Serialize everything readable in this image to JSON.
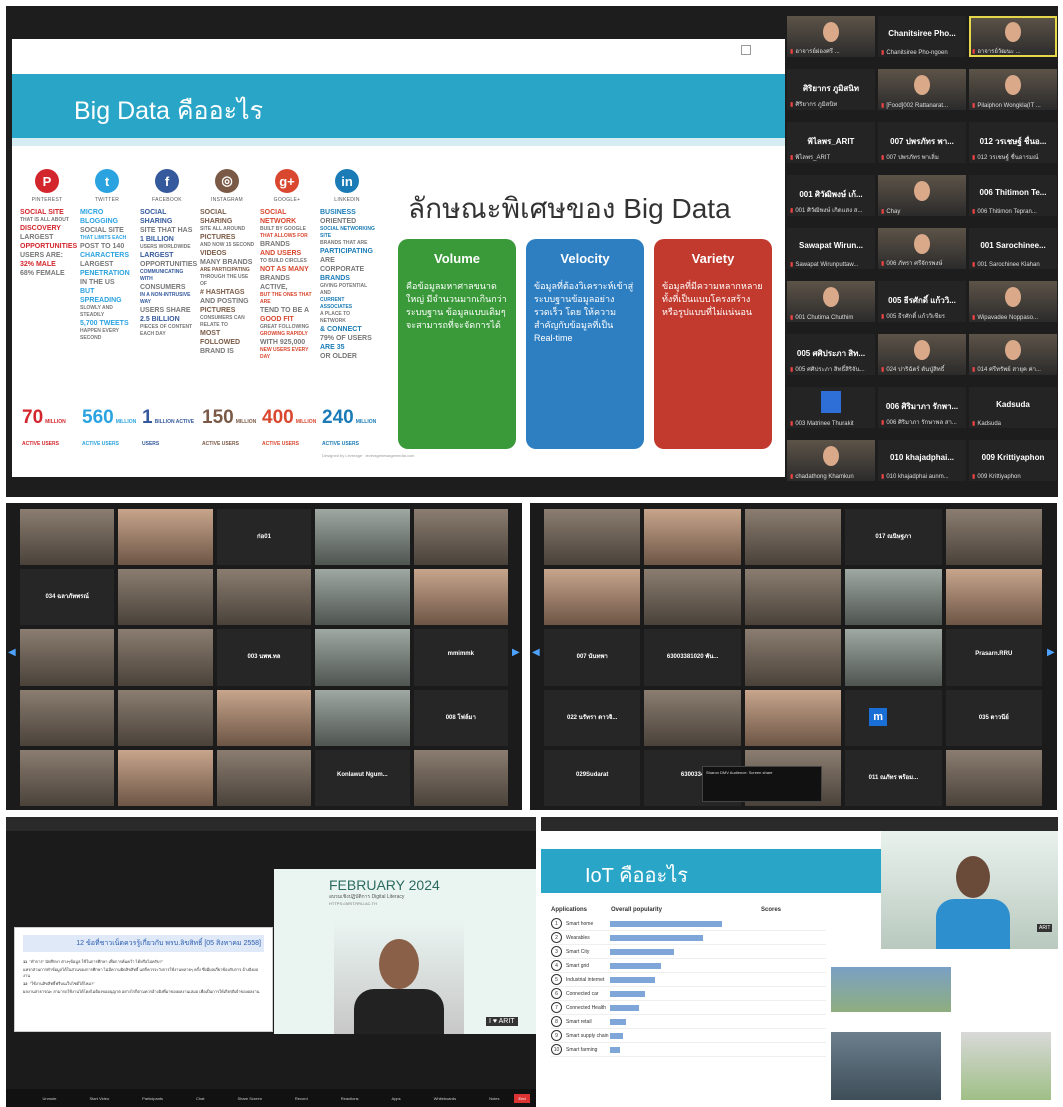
{
  "panel1": {
    "slide_title": "Big Data คืออะไร",
    "social": [
      {
        "icon": "P",
        "name": "PINTEREST",
        "color": "#d3262c",
        "lines": [
          "SOCIAL SITE",
          "THAT IS ALL ABOUT",
          "DISCOVERY",
          "LARGEST",
          "OPPORTUNITIES",
          "USERS ARE:",
          "32% MALE",
          "68% FEMALE"
        ],
        "big": "70",
        "unit": "MILLION ACTIVE USERS"
      },
      {
        "icon": "t",
        "name": "TWITTER",
        "color": "#2aa3e0",
        "lines": [
          "MICRO BLOGGING",
          "SOCIAL SITE",
          "THAT LIMITS EACH",
          "POST TO 140",
          "CHARACTERS",
          "LARGEST",
          "PENETRATION",
          "IN THE US",
          "BUT SPREADING",
          "SLOWLY AND STEADILY",
          "5,700 TWEETS",
          "HAPPEN EVERY SECOND"
        ],
        "big": "560",
        "unit": "MILLION ACTIVE USERS"
      },
      {
        "icon": "f",
        "name": "FACEBOOK",
        "color": "#34599c",
        "lines": [
          "SOCIAL SHARING",
          "SITE THAT HAS",
          "1 BILLION",
          "USERS WORLDWIDE",
          "LARGEST",
          "OPPORTUNITIES",
          "COMMUNICATING WITH",
          "CONSUMERS",
          "IN A NON-INTRUSIVE WAY",
          "USERS SHARE",
          "2.5 BILLION",
          "PIECES OF CONTENT EACH DAY"
        ],
        "big": "1",
        "unit": "BILLION ACTIVE USERS"
      },
      {
        "icon": "◎",
        "name": "INSTAGRAM",
        "color": "#7a5a46",
        "lines": [
          "SOCIAL SHARING",
          "SITE ALL AROUND",
          "PICTURES",
          "AND NOW 15 SECOND",
          "VIDEOS",
          "MANY BRANDS",
          "ARE PARTICIPATING",
          "THROUGH THE USE OF",
          "# HASHTAGS",
          "AND POSTING",
          "PICTURES",
          "CONSUMERS CAN RELATE TO",
          "MOST FOLLOWED",
          "BRAND IS"
        ],
        "big": "150",
        "unit": "MILLION ACTIVE USERS"
      },
      {
        "icon": "g+",
        "name": "GOOGLE+",
        "color": "#d9472f",
        "lines": [
          "SOCIAL NETWORK",
          "BUILT BY GOOGLE",
          "THAT ALLOWS FOR",
          "BRANDS",
          "AND USERS",
          "TO BUILD CIRCLES",
          "NOT AS MANY",
          "BRANDS ACTIVE,",
          "BUT THE ONES THAT ARE",
          "TEND TO BE A",
          "GOOD FIT",
          "GREAT FOLLOWING",
          "GROWING RAPIDLY",
          "WITH 925,000",
          "NEW USERS EVERY DAY"
        ],
        "big": "400",
        "unit": "MILLION ACTIVE USERS"
      },
      {
        "icon": "in",
        "name": "LINKEDIN",
        "color": "#1a7bb6",
        "lines": [
          "BUSINESS",
          "ORIENTED",
          "SOCIAL NETWORKING SITE",
          "BRANDS THAT ARE",
          "PARTICIPATING",
          "ARE CORPORATE",
          "BRANDS",
          "GIVING POTENTIAL AND",
          "CURRENT ASSOCIATES",
          "A PLACE TO NETWORK",
          "& CONNECT",
          "79% OF USERS",
          "ARE 35",
          "OR OLDER"
        ],
        "big": "240",
        "unit": "MILLION ACTIVE USERS"
      }
    ],
    "feature_title": "ลักษณะพิเศษของ Big Data",
    "boxes": [
      {
        "title": "Volume",
        "color": "#3a9a3a",
        "text": "คือข้อมูลมหาศาลขนาดใหญ่ มีจำนวนมากเกินกว่าระบบฐาน ข้อมูลแบบเดิมๆ จะสามารถที่จะจัดการได้"
      },
      {
        "title": "Velocity",
        "color": "#2e7ec2",
        "text": "ข้อมูลที่ต้องวิเคราะห์เข้าสู่ระบบฐานข้อมูลอย่างรวดเร็ว โดย ให้ความสำคัญกับข้อมูลที่เป็น Real-time"
      },
      {
        "title": "Variety",
        "color": "#c23a2e",
        "text": "ข้อมูลที่มีความหลากหลายทั้งที่เป็นแบบโครงสร้างหรือรูปแบบที่ไม่แน่นอน"
      }
    ],
    "credit": "Designed by Leverage · leveragenewagemedia.com",
    "participants": [
      {
        "name": "",
        "caption": "อาจารย์ผ่องศรี ...",
        "photo": true
      },
      {
        "name": "Chanitsiree Pho...",
        "caption": "Chanitsiree Pho-ngoen",
        "photo": false
      },
      {
        "name": "",
        "caption": "อาจารย์วัฒนะ ...",
        "photo": true,
        "active": true
      },
      {
        "name": "ศิริยากร ภูมิสนิท",
        "caption": "ศิริยากร ภูมิสนิท",
        "photo": false
      },
      {
        "name": "",
        "caption": "[Food]002 Rattanarat...",
        "photo": true
      },
      {
        "name": "",
        "caption": "Pilaiphon Wongkla(IT ...",
        "photo": true
      },
      {
        "name": "พิไลพร_ARIT",
        "caption": "พิไลพร_ARIT",
        "photo": false
      },
      {
        "name": "007 ปพรภัทร พา...",
        "caption": "007 ปพรภัทร พาเลิ่ม",
        "photo": false
      },
      {
        "name": "012 วรเชษฐ์ ชื่นอ...",
        "caption": "012 วรเชษฐ์ ชื่นอารมณ์",
        "photo": false
      },
      {
        "name": "001 ศิวัฒิพงษ์ เก้...",
        "caption": "001 ศิวัฒิพงษ์ เกิดแสง ส...",
        "photo": false
      },
      {
        "name": "",
        "caption": "Chay",
        "photo": true
      },
      {
        "name": "006 Thitimon Te...",
        "caption": "006 Thitimon Tepran...",
        "photo": false
      },
      {
        "name": "Sawapat Wirun...",
        "caption": "Sawapat Wirunputtaw...",
        "photo": false
      },
      {
        "name": "",
        "caption": "006 ภัทรา ศรีจักรพงษ์",
        "photo": true
      },
      {
        "name": "001 Sarochinee...",
        "caption": "001 Sarochinee Klahan",
        "photo": false
      },
      {
        "name": "",
        "caption": "001 Chutima Chuthim",
        "photo": true
      },
      {
        "name": "005 ธีรศักดิ์ แก้ววิ...",
        "caption": "005 ธีรศักดิ์ แก้ววิเชียร",
        "photo": false
      },
      {
        "name": "",
        "caption": "Wipavadee Noppaso...",
        "photo": true
      },
      {
        "name": "005 ศศิประภา สิท...",
        "caption": "005 ศศิประภา สิทธิ์สิริจัน...",
        "photo": false
      },
      {
        "name": "",
        "caption": "024 ปาริฉัตร์ ตันปู่สิทธิ์",
        "photo": true
      },
      {
        "name": "",
        "caption": "014 ศรีทรัพย์ สายุค ค่า...",
        "photo": true
      },
      {
        "name": "",
        "caption": "003 Matrinee Thurakit",
        "photo": false,
        "avatar": true
      },
      {
        "name": "006 ศิริมาภา รักพา...",
        "caption": "006 ศิริมาภา รักษาพล สา...",
        "photo": false
      },
      {
        "name": "Kadsuda",
        "caption": "Kadsuda",
        "photo": false
      },
      {
        "name": "",
        "caption": "chadathong Khamkun",
        "photo": true
      },
      {
        "name": "010 khajadphai...",
        "caption": "010 khajadphai aunm...",
        "photo": false
      },
      {
        "name": "009 Krittiyaphon",
        "caption": "009 Krittiyaphon",
        "photo": false
      }
    ]
  },
  "panel2": {
    "cells": [
      "",
      "",
      "ก่อ01",
      "",
      "",
      "034 ฉลาภัทพรณ์",
      "",
      "",
      "",
      "",
      "",
      "",
      "003 นพพ.ทล",
      "",
      "mmimmk",
      "",
      "",
      "",
      "",
      "008 โฟล์มา",
      "",
      "",
      "",
      "Konlawut Ngum...",
      ""
    ]
  },
  "panel3": {
    "cells": [
      "",
      "",
      "",
      "017 ณนิษฐภา",
      "",
      "",
      "",
      "",
      "",
      "",
      "007 นันทพา",
      "63003381020 พัน...",
      "",
      "",
      "Prasarn.RRU",
      "022 นรัทรา ดาวจิ...",
      "",
      "",
      "m",
      "035 ดาวนีย์",
      "029Sudarat",
      "6300334",
      "",
      "011 ณภัทร พร้อม...",
      ""
    ],
    "toast": "Sharon DMV Audience: Screen share"
  },
  "panel4": {
    "slide_header": "12 ข้อที่ชาวเน็ตควรรู้เกี่ยวกับ พรบ.ลิขสิทธิ์ [05 สิงหาคม 2558]",
    "item11_num": "11",
    "item11": "\"ทำการ\" นักศึกษา ต่างๆข้อมูล ใช้ในการศึกษา เพื่อการค้นคว้า ได้หรือไม่ครับ?\"",
    "item11_body": "แทรกส่วนการทำข้อมูลได้ในส่วนของการศึกษา ไม่มีความผิดลิขสิทธิ์ แต่ก็ควรระวังการใช้งานหลายๆ ครั้ง ซึ่งมีผลเกี่ยวข้องกับการ อ้างอิงผลงาน",
    "item12_num": "12",
    "item12": "\"ใช้งานลิขสิทธิ์ฟรีบนเว็บไซต์ได้ไหม?\"",
    "item12_body": "ผลงานสาธารณะ สามารถใช้งานได้โดยไม่ต้องขออนุญาต อย่างไรก็ตามควรอ้างอิงที่มาของผลงานเสมอ เพื่อเป็นการให้เกียรติเจ้าของผลงาน",
    "month": "FEBRUARY 2024",
    "sub": "อบรมเชิงปฏิบัติการ Digital Literacy",
    "site": "HTTPS://ARIT.RRU.AC.TH",
    "heart": "I ♥ ARIT",
    "toolbar": [
      "Unmute",
      "Start Video",
      "Participants",
      "Chat",
      "Share Screen",
      "Record",
      "Reactions",
      "Apps",
      "Whiteboards",
      "Notes"
    ],
    "end": "End"
  },
  "panel5": {
    "title": "IoT คืออะไร",
    "table_head": "Applications",
    "table_head2": "Overall popularity",
    "table_head3": "Scores",
    "rows": [
      {
        "n": "1",
        "label": "Smart home",
        "w": 70
      },
      {
        "n": "2",
        "label": "Wearables",
        "w": 58
      },
      {
        "n": "3",
        "label": "Smart City",
        "w": 40
      },
      {
        "n": "4",
        "label": "Smart grid",
        "w": 32
      },
      {
        "n": "5",
        "label": "Industrial internet",
        "w": 28
      },
      {
        "n": "6",
        "label": "Connected car",
        "w": 22
      },
      {
        "n": "7",
        "label": "Connected Health",
        "w": 18
      },
      {
        "n": "8",
        "label": "Smart retail",
        "w": 10
      },
      {
        "n": "9",
        "label": "Smart supply chain",
        "w": 8
      },
      {
        "n": "10",
        "label": "Smart farming",
        "w": 6
      }
    ],
    "arit": "ARIT"
  }
}
